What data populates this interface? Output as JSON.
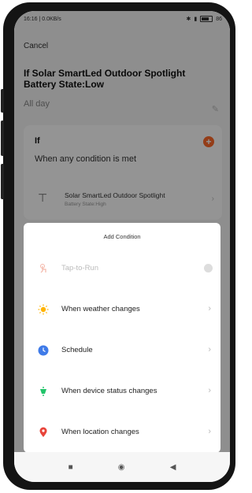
{
  "status_bar": {
    "time": "16:16 | 0.0KB/s",
    "battery": "86"
  },
  "header": {
    "cancel_label": "Cancel",
    "title": "If Solar SmartLed Outdoor Spotlight Battery State:Low",
    "subtitle": "All day"
  },
  "if_section": {
    "label": "If",
    "mode": "When any condition is met",
    "condition_title": "Solar SmartLed Outdoor Spotlight",
    "condition_desc": "Battery State:High"
  },
  "sheet": {
    "title": "Add Condition",
    "options": [
      {
        "label": "Tap-to-Run",
        "icon": "hand-tap-icon",
        "enabled": false
      },
      {
        "label": "When weather changes",
        "icon": "sun-icon",
        "enabled": true
      },
      {
        "label": "Schedule",
        "icon": "clock-icon",
        "enabled": true
      },
      {
        "label": "When device status changes",
        "icon": "device-icon",
        "enabled": true
      },
      {
        "label": "When location changes",
        "icon": "location-pin-icon",
        "enabled": true
      }
    ]
  },
  "colors": {
    "accent_orange": "#ff6a2a",
    "sun": "#ffb300",
    "clock": "#3f7be8",
    "device": "#22c46a",
    "location": "#e8443a"
  }
}
